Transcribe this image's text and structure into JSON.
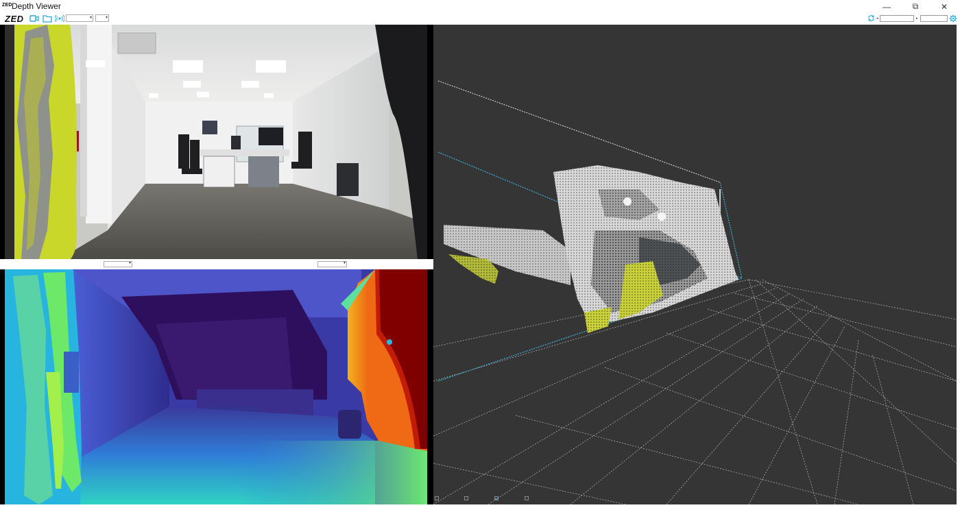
{
  "window": {
    "logo_small": "ZED",
    "title": "Depth Viewer",
    "minimize_glyph": "—",
    "restore_glyph": "⧉",
    "close_glyph": "✕"
  },
  "toolbar": {
    "logo": "ZED",
    "icons": [
      "camera-icon",
      "folder-icon",
      "stream-icon",
      "refresh-icon",
      "settings-icon"
    ],
    "accent_color": "#2aa7d8",
    "resolution_value": "",
    "fps_value": "",
    "fps_label": "",
    "range_min_marker": "◂",
    "range_max_marker": "▸",
    "range_min_value": "",
    "range_max_value": ""
  },
  "views": {
    "left_label": "",
    "left_select_value": "",
    "right_label": "",
    "right_select_value": ""
  },
  "cloud_options": {
    "items": [
      {
        "label": "",
        "checked": false
      },
      {
        "label": "",
        "checked": false
      },
      {
        "label": "",
        "checked": true
      },
      {
        "label": "",
        "checked": false
      }
    ]
  },
  "status": {
    "left": "",
    "right": ""
  },
  "colors": {
    "cloud_background": "#353535",
    "grid_line": "#bdbdbd",
    "frustum_cyan": "#3fb2d8",
    "depth_near": "#7a0000",
    "depth_far": "#30126a"
  }
}
